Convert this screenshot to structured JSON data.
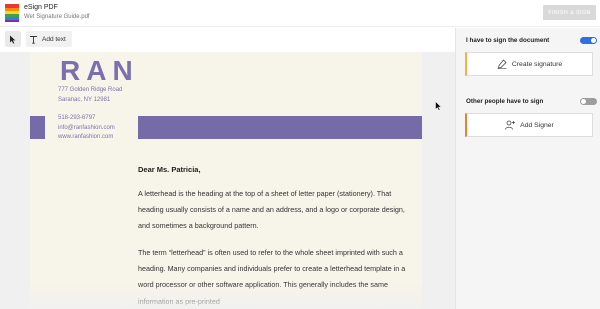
{
  "app": {
    "title": "eSign PDF",
    "file_name": "Wet Signature Guide.pdf",
    "finish_label": "FINISH & SIGN"
  },
  "toolbar": {
    "pointer_icon": "cursor-arrow-icon",
    "add_text_label": "Add text"
  },
  "document": {
    "brand": "RAN",
    "address_line1": "777 Golden Ridge Road",
    "address_line2": "Saranac, NY 12981",
    "phone": "518-293-6797",
    "email": "info@ranfashion.com",
    "website": "www.ranfashion.com",
    "greeting": "Dear Ms. Patricia,",
    "paragraph1": "A letterhead is the heading at the top of a sheet of letter paper (stationery). That heading usually consists of a name and an address, and a logo or corporate design, and sometimes a background pattern.",
    "paragraph2": "The term “letterhead” is often used to refer to the whole sheet imprinted with such a heading. Many companies and individuals prefer to create a letterhead template in a word processor or other software application. This generally includes the same information as pre-printed"
  },
  "panel": {
    "self_sign_label": "I have to sign the document",
    "self_sign_on": true,
    "create_signature_label": "Create signature",
    "others_label": "Other people have to sign",
    "others_on": false,
    "add_signer_label": "Add Signer"
  },
  "colors": {
    "brand_purple": "#756ba8",
    "toggle_on": "#2f6fe0",
    "toggle_off": "#9e9e9e",
    "accent_yellow": "#f3b23b",
    "accent_orange": "#e7842e"
  }
}
